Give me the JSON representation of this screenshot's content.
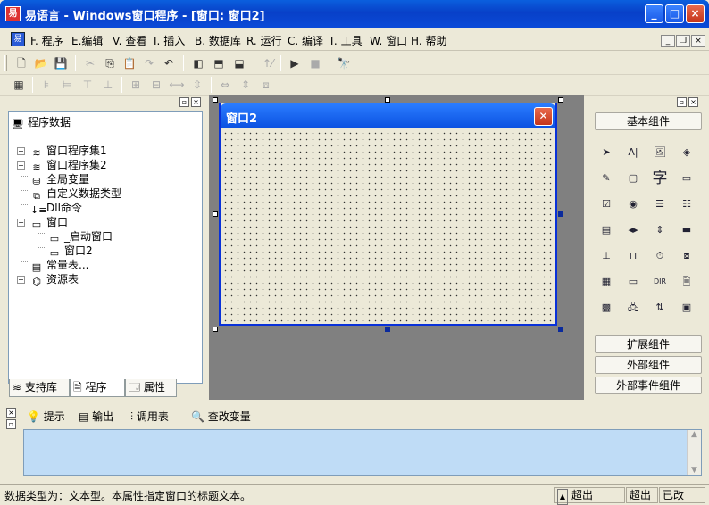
{
  "window": {
    "title": "易语言 - Windows窗口程序 - [窗口: 窗口2]",
    "app_icon_char": "易"
  },
  "titlebar_buttons": {
    "minimize": "_",
    "maximize": "□",
    "close": "×"
  },
  "menu": [
    {
      "key": "F.",
      "label": "程序"
    },
    {
      "key": "E.",
      "label": "编辑"
    },
    {
      "key": "V.",
      "label": "查看"
    },
    {
      "key": "I.",
      "label": "插入"
    },
    {
      "key": "B.",
      "label": "数据库"
    },
    {
      "key": "R.",
      "label": "运行"
    },
    {
      "key": "C.",
      "label": "编译"
    },
    {
      "key": "T.",
      "label": "工具"
    },
    {
      "key": "W.",
      "label": "窗口"
    },
    {
      "key": "H.",
      "label": "帮助"
    }
  ],
  "tree": {
    "root": "程序数据",
    "items": [
      {
        "label": "窗口程序集1",
        "icon": "stack-icon"
      },
      {
        "label": "窗口程序集2",
        "icon": "stack-icon"
      },
      {
        "label": "全局变量",
        "icon": "barrel-icon"
      },
      {
        "label": "自定义数据类型",
        "icon": "type-icon"
      },
      {
        "label": "Dll命令",
        "icon": "dll-icon"
      },
      {
        "label": "窗口",
        "icon": "window-icon"
      },
      {
        "label": "_启动窗口",
        "icon": "window-icon"
      },
      {
        "label": "窗口2",
        "icon": "window-icon"
      },
      {
        "label": "常量表...",
        "icon": "const-icon"
      },
      {
        "label": "资源表",
        "icon": "resource-icon"
      }
    ]
  },
  "left_tabs": [
    "支持库",
    "程序",
    "属性"
  ],
  "form": {
    "title": "窗口2"
  },
  "right_panel": {
    "basic": "基本组件",
    "extended": "扩展组件",
    "external": "外部组件",
    "external_event": "外部事件组件"
  },
  "bottom_tabs": [
    "提示",
    "输出",
    "调用表",
    "查改变量"
  ],
  "status": {
    "message": "数据类型为：文本型。本属性指定窗口的标题文本。",
    "box1": "超出",
    "box2": "超出",
    "box3": "已改"
  }
}
